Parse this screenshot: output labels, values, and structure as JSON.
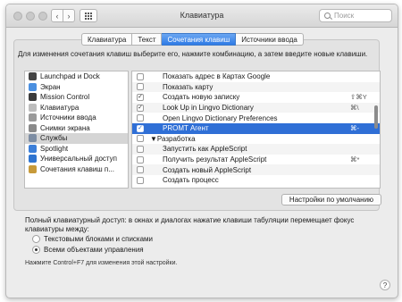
{
  "window": {
    "title": "Клавиатура"
  },
  "toolbar": {
    "search_placeholder": "Поиск"
  },
  "tabs": [
    {
      "label": "Клавиатура",
      "active": false
    },
    {
      "label": "Текст",
      "active": false
    },
    {
      "label": "Сочетания клавиш",
      "active": true
    },
    {
      "label": "Источники ввода",
      "active": false
    }
  ],
  "instructions": "Для изменения сочетания клавиш выберите его, нажмите комбинацию, а затем введите новые клавиши.",
  "categories": [
    {
      "label": "Launchpad и Dock",
      "icon": "launchpad-icon",
      "color": "#444444"
    },
    {
      "label": "Экран",
      "icon": "display-icon",
      "color": "#4a8fe0"
    },
    {
      "label": "Mission Control",
      "icon": "mission-control-icon",
      "color": "#3b3b3b"
    },
    {
      "label": "Клавиатура",
      "icon": "keyboard-icon",
      "color": "#bdbdbd"
    },
    {
      "label": "Источники ввода",
      "icon": "input-sources-icon",
      "color": "#9a9a9a"
    },
    {
      "label": "Снимки экрана",
      "icon": "camera-icon",
      "color": "#8a8a8a"
    },
    {
      "label": "Службы",
      "icon": "gear-icon",
      "color": "#7d8da3",
      "selected": true
    },
    {
      "label": "Spotlight",
      "icon": "spotlight-icon",
      "color": "#3c7fd9"
    },
    {
      "label": "Универсальный доступ",
      "icon": "accessibility-icon",
      "color": "#2f74d0"
    },
    {
      "label": "Сочетания клавиш п...",
      "icon": "app-shortcuts-icon",
      "color": "#c79a3a"
    }
  ],
  "services": [
    {
      "label": "Показать адрес в Картах Google",
      "checked": false,
      "shortcut": ""
    },
    {
      "label": "Показать карту",
      "checked": false,
      "shortcut": ""
    },
    {
      "label": "Создать новую записку",
      "checked": true,
      "shortcut": "⇧⌘Y"
    },
    {
      "label": "Look Up in Lingvo Dictionary",
      "checked": true,
      "shortcut": "⌘\\"
    },
    {
      "label": "Open Lingvo Dictionary Preferences",
      "checked": false,
      "shortcut": ""
    },
    {
      "label": "PROMT Агент",
      "checked": true,
      "shortcut": "⌘-",
      "selected": true
    },
    {
      "label": "▼Разработка",
      "group": true
    },
    {
      "label": "Запустить как AppleScript",
      "checked": false,
      "shortcut": ""
    },
    {
      "label": "Получить результат AppleScript",
      "checked": false,
      "shortcut": "⌘*"
    },
    {
      "label": "Создать новый AppleScript",
      "checked": false,
      "shortcut": ""
    },
    {
      "label": "Создать процесс",
      "checked": false,
      "shortcut": ""
    }
  ],
  "defaults_button": "Настройки по умолчанию",
  "full_access": {
    "text": "Полный клавиатурный доступ: в окнах и диалогах нажатие клавиши табуляции перемещает фокус клавиатуры между:",
    "options": [
      {
        "label": "Текстовыми блоками и списками",
        "selected": false
      },
      {
        "label": "Всеми объектами управления",
        "selected": true
      }
    ],
    "hint": "Нажмите Control+F7 для изменения этой настройки."
  },
  "help_label": "?"
}
